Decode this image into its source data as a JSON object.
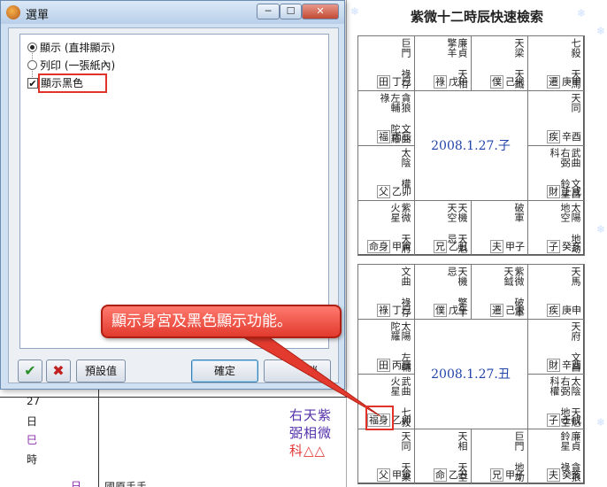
{
  "dialog": {
    "title": "選單",
    "options": [
      {
        "type": "radio",
        "label": "顯示 (直排顯示)",
        "selected": true
      },
      {
        "type": "radio",
        "label": "列印 (一張紙內)",
        "selected": false
      },
      {
        "type": "checkbox",
        "label": "顯示黑色",
        "checked": true,
        "check_glyph": "✔"
      }
    ],
    "ok_icon": "✔",
    "cancel_icon": "✖",
    "defaults_label": "預設值",
    "confirm_label": "確定",
    "cancel_label": "消",
    "title_buttons": {
      "minimize": "─",
      "maximize": "☐",
      "close": "✕"
    }
  },
  "callout": {
    "text": "顯示身宮及黑色顯示功能。",
    "color": "#e23a2e"
  },
  "background": {
    "left_column": [
      "27",
      "日",
      "巳",
      "時",
      "日"
    ],
    "stars_text": [
      "右天紫",
      "弼相微",
      "科△△"
    ],
    "bottom_text": "國原手手"
  },
  "right_panel": {
    "title": "紫微十二時辰快速檢索",
    "charts": [
      {
        "center": "2008.1.27.子",
        "cells": [
          {
            "stars": [
              "巨門",
              "祿存"
            ],
            "palace": "田",
            "stem": "丁巳"
          },
          {
            "stars": [
              "廉貞",
              "天相",
              "擎羊"
            ],
            "palace": "祿",
            "stem": "戊午"
          },
          {
            "stars": [
              "天梁",
              "天鉞"
            ],
            "palace": "僕",
            "stem": "己未"
          },
          {
            "stars": [
              "七殺",
              "天馬"
            ],
            "palace": "遷",
            "stem": "庚申"
          },
          {
            "stars": [
              "貪狼",
              "文曲",
              "左輔",
              "陀羅"
            ],
            "sub": "祿",
            "palace": "福",
            "stem": "丙辰"
          },
          {
            "stars": [
              "天同"
            ],
            "palace": "疾",
            "stem": "辛酉"
          },
          {
            "stars": [
              "太陰"
            ],
            "sub": "權",
            "palace": "父",
            "stem": "乙卯"
          },
          {
            "stars": [
              "武曲",
              "文昌",
              "右弼",
              "鈴星"
            ],
            "sub": "科",
            "palace": "財",
            "stem": "壬戌"
          },
          {
            "stars": [
              "紫微",
              "天府",
              "火星"
            ],
            "palace": "命身",
            "stem": "甲寅"
          },
          {
            "stars": [
              "天機",
              "天魁",
              "天空"
            ],
            "sub": "忌",
            "palace": "兄",
            "stem": "乙丑"
          },
          {
            "stars": [
              "破軍"
            ],
            "palace": "夫",
            "stem": "甲子"
          },
          {
            "stars": [
              "太陽",
              "地劫",
              "地空"
            ],
            "palace": "子",
            "stem": "癸亥"
          }
        ]
      },
      {
        "center": "2008.1.27.丑",
        "cells": [
          {
            "stars": [
              "文曲",
              "祿存"
            ],
            "palace": "祿",
            "stem": "丁巳"
          },
          {
            "stars": [
              "天機",
              "擎羊"
            ],
            "sub": "忌",
            "palace": "僕",
            "stem": "戊午"
          },
          {
            "stars": [
              "紫微",
              "破軍",
              "天鉞"
            ],
            "palace": "遷",
            "stem": "己未"
          },
          {
            "stars": [
              "天馬"
            ],
            "palace": "疾",
            "stem": "庚申"
          },
          {
            "stars": [
              "太陽",
              "左輔",
              "陀羅"
            ],
            "palace": "田",
            "stem": "丙辰"
          },
          {
            "stars": [
              "天府",
              "文昌"
            ],
            "palace": "財",
            "stem": "辛酉"
          },
          {
            "stars": [
              "武曲",
              "七殺",
              "火星"
            ],
            "palace": "福身",
            "stem": "乙卯"
          },
          {
            "stars": [
              "太陰",
              "天魁",
              "右弼",
              "地空"
            ],
            "sub": "科權",
            "palace": "子",
            "stem": "壬戌"
          },
          {
            "stars": [
              "天同",
              "天梁"
            ],
            "palace": "父",
            "stem": "甲寅"
          },
          {
            "stars": [
              "天相",
              "天空"
            ],
            "palace": "命",
            "stem": "乙丑"
          },
          {
            "stars": [
              "巨門",
              "地劫"
            ],
            "palace": "兄",
            "stem": "甲子"
          },
          {
            "stars": [
              "廉貞",
              "貪狼",
              "鈴星"
            ],
            "sub": "祿",
            "palace": "夫",
            "stem": "癸亥"
          }
        ]
      }
    ]
  }
}
